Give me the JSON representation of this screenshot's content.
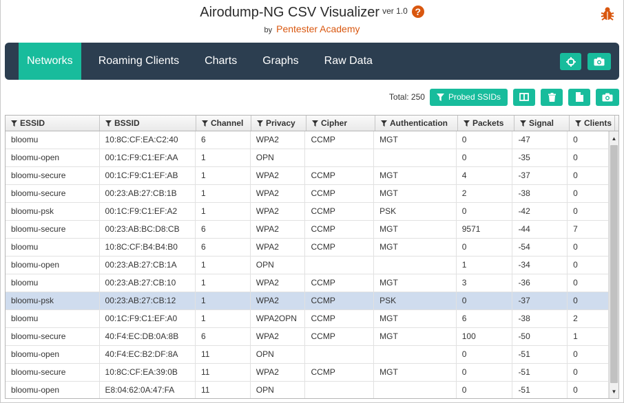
{
  "header": {
    "title": "Airodump-NG CSV Visualizer",
    "version": "ver 1.0",
    "help": "?",
    "by": "by",
    "author": "Pentester Academy"
  },
  "nav": {
    "tabs": [
      {
        "label": "Networks",
        "active": true
      },
      {
        "label": "Roaming Clients",
        "active": false
      },
      {
        "label": "Charts",
        "active": false
      },
      {
        "label": "Graphs",
        "active": false
      },
      {
        "label": "Raw Data",
        "active": false
      }
    ]
  },
  "toolbar": {
    "total": "Total: 250",
    "probed_label": "Probed SSIDs"
  },
  "table": {
    "columns": [
      "ESSID",
      "BSSID",
      "Channel",
      "Privacy",
      "Cipher",
      "Authentication",
      "Packets",
      "Signal",
      "Clients"
    ],
    "rows": [
      [
        "bloomu",
        "10:8C:CF:EA:C2:40",
        "6",
        "WPA2",
        "CCMP",
        "MGT",
        "0",
        "-47",
        "0"
      ],
      [
        "bloomu-open",
        "00:1C:F9:C1:EF:AA",
        "1",
        "OPN",
        "",
        "",
        "0",
        "-35",
        "0"
      ],
      [
        "bloomu-secure",
        "00:1C:F9:C1:EF:AB",
        "1",
        "WPA2",
        "CCMP",
        "MGT",
        "4",
        "-37",
        "0"
      ],
      [
        "bloomu-secure",
        "00:23:AB:27:CB:1B",
        "1",
        "WPA2",
        "CCMP",
        "MGT",
        "2",
        "-38",
        "0"
      ],
      [
        "bloomu-psk",
        "00:1C:F9:C1:EF:A2",
        "1",
        "WPA2",
        "CCMP",
        "PSK",
        "0",
        "-42",
        "0"
      ],
      [
        "bloomu-secure",
        "00:23:AB:BC:D8:CB",
        "6",
        "WPA2",
        "CCMP",
        "MGT",
        "9571",
        "-44",
        "7"
      ],
      [
        "bloomu",
        "10:8C:CF:B4:B4:B0",
        "6",
        "WPA2",
        "CCMP",
        "MGT",
        "0",
        "-54",
        "0"
      ],
      [
        "bloomu-open",
        "00:23:AB:27:CB:1A",
        "1",
        "OPN",
        "",
        "",
        "1",
        "-34",
        "0"
      ],
      [
        "bloomu",
        "00:23:AB:27:CB:10",
        "1",
        "WPA2",
        "CCMP",
        "MGT",
        "3",
        "-36",
        "0"
      ],
      [
        "bloomu-psk",
        "00:23:AB:27:CB:12",
        "1",
        "WPA2",
        "CCMP",
        "PSK",
        "0",
        "-37",
        "0"
      ],
      [
        "bloomu",
        "00:1C:F9:C1:EF:A0",
        "1",
        "WPA2OPN",
        "CCMP",
        "MGT",
        "6",
        "-38",
        "2"
      ],
      [
        "bloomu-secure",
        "40:F4:EC:DB:0A:8B",
        "6",
        "WPA2",
        "CCMP",
        "MGT",
        "100",
        "-50",
        "1"
      ],
      [
        "bloomu-open",
        "40:F4:EC:B2:DF:8A",
        "11",
        "OPN",
        "",
        "",
        "0",
        "-51",
        "0"
      ],
      [
        "bloomu-secure",
        "10:8C:CF:EA:39:0B",
        "11",
        "WPA2",
        "CCMP",
        "MGT",
        "0",
        "-51",
        "0"
      ],
      [
        "bloomu-open",
        "E8:04:62:0A:47:FA",
        "11",
        "OPN",
        "",
        "",
        "0",
        "-51",
        "0"
      ]
    ],
    "selected_row": 9
  },
  "colors": {
    "accent": "#18bc9c",
    "navbar": "#2c3e50",
    "brand": "#d9570f",
    "selected_row": "#cfdcee"
  },
  "icons": {
    "help": "question-circle-icon",
    "bug": "bug-icon",
    "crosshair": "crosshairs-icon",
    "camera": "camera-icon",
    "filter": "filter-icon",
    "columns": "columns-icon",
    "trash": "trash-icon",
    "file": "file-icon"
  }
}
